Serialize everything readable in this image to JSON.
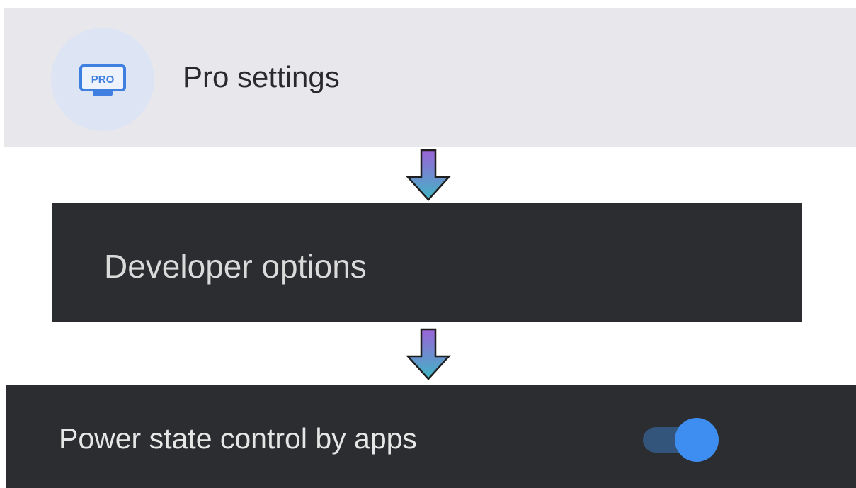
{
  "pro_settings": {
    "label": "Pro settings",
    "icon": "pro-monitor-icon",
    "icon_text": "PRO",
    "accent": "#3f7fe0"
  },
  "developer_options": {
    "label": "Developer options"
  },
  "power_state": {
    "label": "Power state control by apps",
    "toggle_on": true,
    "accent": "#3d8ef0"
  },
  "arrow": {
    "icon": "arrow-down-icon",
    "gradient_top": "#9b63d8",
    "gradient_bottom": "#3fb6c4"
  }
}
